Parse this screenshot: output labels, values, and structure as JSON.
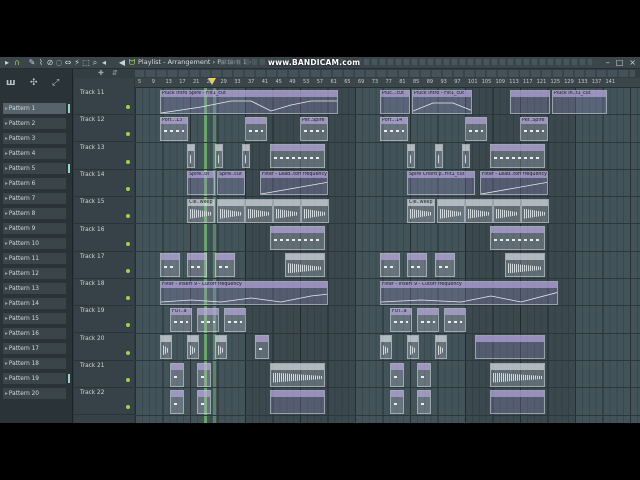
{
  "titlebar": {
    "crumb": "Playlist - Arrangement › Pattern 1 ›",
    "watermark": "www.BANDICAM.com"
  },
  "patterns": [
    "Pattern 1",
    "Pattern 2",
    "Pattern 3",
    "Pattern 4",
    "Pattern 5",
    "Pattern 6",
    "Pattern 7",
    "Pattern 8",
    "Pattern 9",
    "Pattern 10",
    "Pattern 11",
    "Pattern 12",
    "Pattern 13",
    "Pattern 14",
    "Pattern 15",
    "Pattern 16",
    "Pattern 17",
    "Pattern 18",
    "Pattern 19",
    "Pattern 20"
  ],
  "tracks": [
    "Track 11",
    "Track 12",
    "Track 13",
    "Track 14",
    "Track 15",
    "Track 16",
    "Track 17",
    "Track 18",
    "Track 19",
    "Track 20",
    "Track 21",
    "Track 22"
  ],
  "ruler": [
    "5",
    "9",
    "13",
    "17",
    "21",
    "25",
    "29",
    "33",
    "37",
    "41",
    "45",
    "49",
    "53",
    "57",
    "61",
    "65",
    "69",
    "73",
    "77",
    "81",
    "85",
    "89",
    "93",
    "97",
    "101",
    "105",
    "109",
    "113",
    "117",
    "121",
    "125",
    "129",
    "133",
    "137",
    "141"
  ],
  "clips": {
    "t11a": "Pluck Intro Spire - Filt1_cut",
    "t11b": "Pluc...cut",
    "t11c": "Pluck Intro - Filt1_cut",
    "t11d": "Pluck In..t1_cut",
    "t12a": "Port...13",
    "t12b": "Per..Spire",
    "t12c": "Port...14",
    "t12d": "Per..Spire",
    "t14a": "Spire..ut",
    "t14b": "Spire..cut",
    "t14c": "Filter - Lead..toff frequency",
    "t14d": "Spire Chord p..Filt1_cut",
    "t14e": "Filter - Lead..toff frequency",
    "t15a": "Cle..weep",
    "t15b": "Cle..weep",
    "t18a": "Filter - Insert 9 - Cutoff frequency",
    "t18b": "Filter - Insert 9 - Cutoff frequency",
    "t19a": "FUT..a",
    "t19b": "FUT..a"
  },
  "colors": {
    "accent": "#9ed34a",
    "playhead": "#f2d14a",
    "grid_bg": "#43535a"
  }
}
